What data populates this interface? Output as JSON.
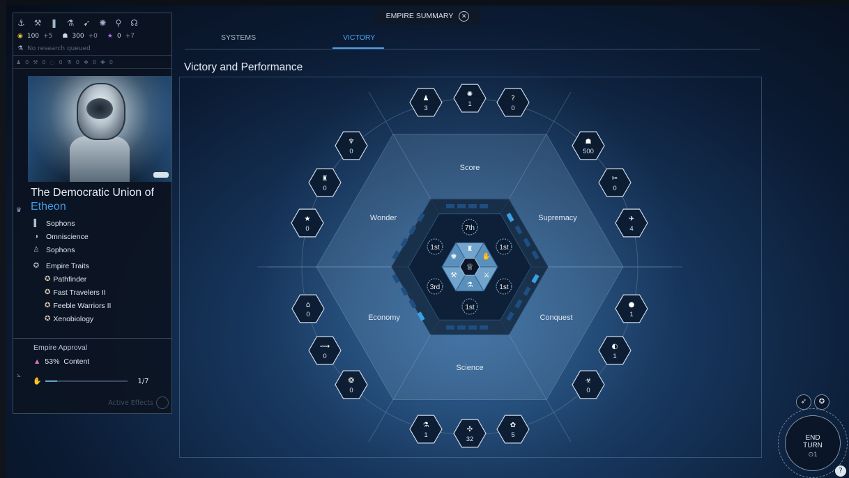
{
  "header": {
    "title": "EMPIRE SUMMARY",
    "close_icon": "close-icon"
  },
  "tabs": [
    {
      "label": "SYSTEMS",
      "active": false
    },
    {
      "label": "VICTORY",
      "active": true
    }
  ],
  "page_title": "Victory and Performance",
  "top_icons": [
    "fleet-icon",
    "industry-icon",
    "dust-icon",
    "science-icon",
    "influence-icon",
    "approval-icon",
    "strategic-icon",
    "diplomacy-icon"
  ],
  "resources": {
    "dust": {
      "value": "100",
      "delta": "+5"
    },
    "population": {
      "value": "300",
      "delta": "+0"
    },
    "influence": {
      "value": "0",
      "delta": "+7"
    }
  },
  "research_text": "No research queued",
  "stats": [
    "0",
    "0",
    "0",
    "0",
    "0",
    "0"
  ],
  "empire": {
    "name_line1": "The Democratic Union of",
    "name_line2": "Etheon",
    "affinity": "Sophons",
    "ideology": "Omniscience",
    "population": "Sophons",
    "traits_label": "Empire Traits",
    "traits": [
      "Pathfinder",
      "Fast Travelers II",
      "Feeble Warriors II",
      "Xenobiology"
    ]
  },
  "approval": {
    "title": "Empire Approval",
    "percent": "53%",
    "status": "Content",
    "progress_fraction": "1/7",
    "progress": 0.14,
    "active_effects": "Active Effects"
  },
  "victory": {
    "sectors": [
      "Score",
      "Supremacy",
      "Conquest",
      "Science",
      "Economy",
      "Wonder"
    ],
    "ranks": {
      "score": "7th",
      "supremacy": "1st",
      "conquest": "1st",
      "science": "1st",
      "economy": "3rd",
      "wonder": "1st"
    },
    "hexes": [
      {
        "icon": "population-icon",
        "value": "3"
      },
      {
        "icon": "approval-icon",
        "value": "1"
      },
      {
        "icon": "unknown-icon",
        "value": "0"
      },
      {
        "icon": "citizens-icon",
        "value": "500"
      },
      {
        "icon": "diplomacy-icon",
        "value": "0"
      },
      {
        "icon": "system-icon",
        "value": "4"
      },
      {
        "icon": "bomb-icon",
        "value": "1"
      },
      {
        "icon": "planet-icon",
        "value": "1"
      },
      {
        "icon": "alien-icon",
        "value": "0"
      },
      {
        "icon": "science-icon",
        "value": "5"
      },
      {
        "icon": "technology-icon",
        "value": "32"
      },
      {
        "icon": "flask-icon",
        "value": "1"
      },
      {
        "icon": "resource-icon",
        "value": "0"
      },
      {
        "icon": "trade-route-icon",
        "value": "0"
      },
      {
        "icon": "market-icon",
        "value": "0"
      },
      {
        "icon": "star-icon",
        "value": "0"
      },
      {
        "icon": "monument-icon",
        "value": "0"
      },
      {
        "icon": "trophy-icon",
        "value": "0"
      }
    ]
  },
  "end_turn": {
    "line1": "END",
    "line2": "TURN",
    "count": "⊙1"
  }
}
